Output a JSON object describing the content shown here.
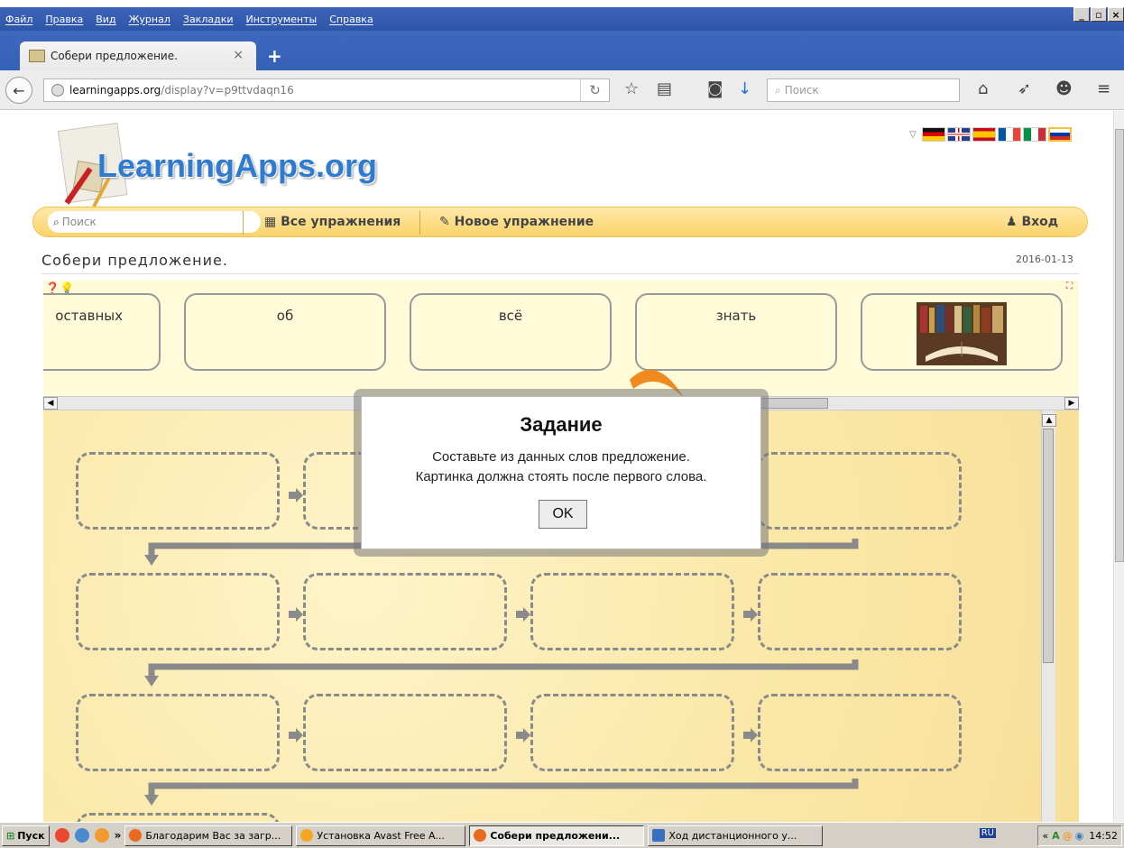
{
  "menubar": {
    "items": [
      "Файл",
      "Правка",
      "Вид",
      "Журнал",
      "Закладки",
      "Инструменты",
      "Справка"
    ]
  },
  "tab": {
    "title": "Собери предложение.",
    "close": "×",
    "new_tab": "+"
  },
  "navbar": {
    "url_host": "learningapps.org",
    "url_path": "/display?v=p9ttvdaqn16",
    "search_placeholder": "Поиск"
  },
  "site": {
    "logo": "LearningApps.org",
    "search_placeholder": "Поиск",
    "nav": {
      "all": "Все упражнения",
      "new": "Новое упражнение",
      "login": "Вход"
    },
    "flags": [
      "de",
      "gb",
      "es",
      "fr",
      "it",
      "ru"
    ]
  },
  "app": {
    "title": "Собери предложение.",
    "date": "2016-01-13",
    "cards": [
      "оставных",
      "об",
      "всё",
      "знать"
    ]
  },
  "dialog": {
    "title": "Задание",
    "line1": "Составьте из данных слов предложение.",
    "line2": "Картинка должна стоять после первого слова.",
    "ok": "OK"
  },
  "taskbar": {
    "start": "Пуск",
    "more": "»",
    "tasks": [
      "Благодарим Вас за загр...",
      "Установка Avast Free A...",
      "Собери предложени...",
      "Ход дистанционного у..."
    ],
    "lang": "RU",
    "tray_more": "«",
    "clock": "14:52"
  },
  "colors": {
    "titlebar": "#2d55a8",
    "accent": "#fbd36b",
    "board": "#fbe9ab"
  }
}
